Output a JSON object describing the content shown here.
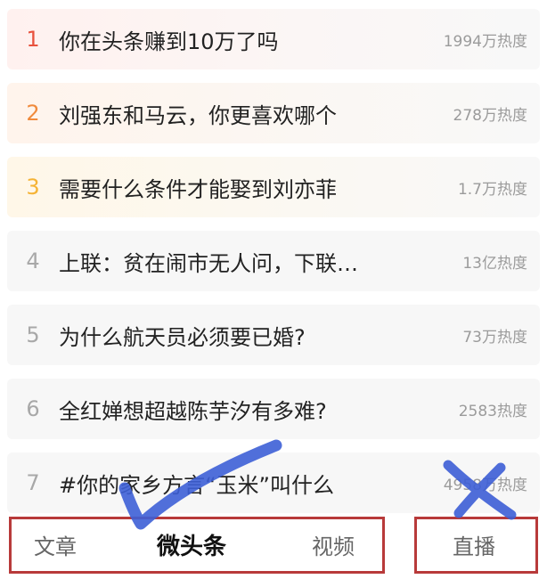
{
  "hot_list": [
    {
      "rank": "1",
      "title": "你在头条赚到10万了吗",
      "heat": "1994万热度"
    },
    {
      "rank": "2",
      "title": "刘强东和马云，你更喜欢哪个",
      "heat": "278万热度"
    },
    {
      "rank": "3",
      "title": "需要什么条件才能娶到刘亦菲",
      "heat": "1.7万热度"
    },
    {
      "rank": "4",
      "title": "上联：贫在闹市无人问，下联…",
      "heat": "13亿热度"
    },
    {
      "rank": "5",
      "title": "为什么航天员必须要已婚?",
      "heat": "73万热度"
    },
    {
      "rank": "6",
      "title": "全红婵想超越陈芋汐有多难?",
      "heat": "2583热度"
    },
    {
      "rank": "7",
      "title": "#你的家乡方言“玉米”叫什么",
      "heat": "4958万热度"
    }
  ],
  "tabs": {
    "article": "文章",
    "micro": "微头条",
    "video": "视频",
    "live": "直播"
  },
  "annotations": {
    "box_color": "#b83a3a",
    "check_color": "#3d5fd6",
    "cross_color": "#3d5fd6"
  }
}
